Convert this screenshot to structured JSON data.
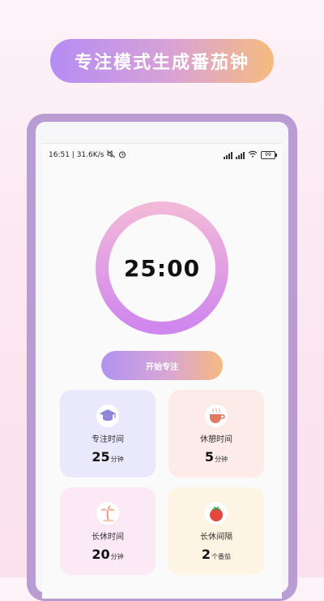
{
  "banner": {
    "title": "专注模式生成番茄钟"
  },
  "status_bar": {
    "time_speed": "16:51 | 31.6K/s",
    "battery": "99"
  },
  "timer": {
    "display": "25:00"
  },
  "start_button": {
    "label": "开始专注"
  },
  "cards": [
    {
      "label": "专注时间",
      "value": "25",
      "unit": "分钟",
      "icon": "graduation-cap-icon"
    },
    {
      "label": "休憩时间",
      "value": "5",
      "unit": "分钟",
      "icon": "coffee-cup-icon"
    },
    {
      "label": "长休时间",
      "value": "20",
      "unit": "分钟",
      "icon": "palm-tree-icon"
    },
    {
      "label": "长休间隔",
      "value": "2",
      "unit": "个番茄",
      "icon": "tomato-icon"
    }
  ],
  "colors": {
    "ring_start": "#f2b8d8",
    "ring_end": "#cf86ee",
    "button_start": "#b092f0",
    "button_end": "#f5b980"
  }
}
